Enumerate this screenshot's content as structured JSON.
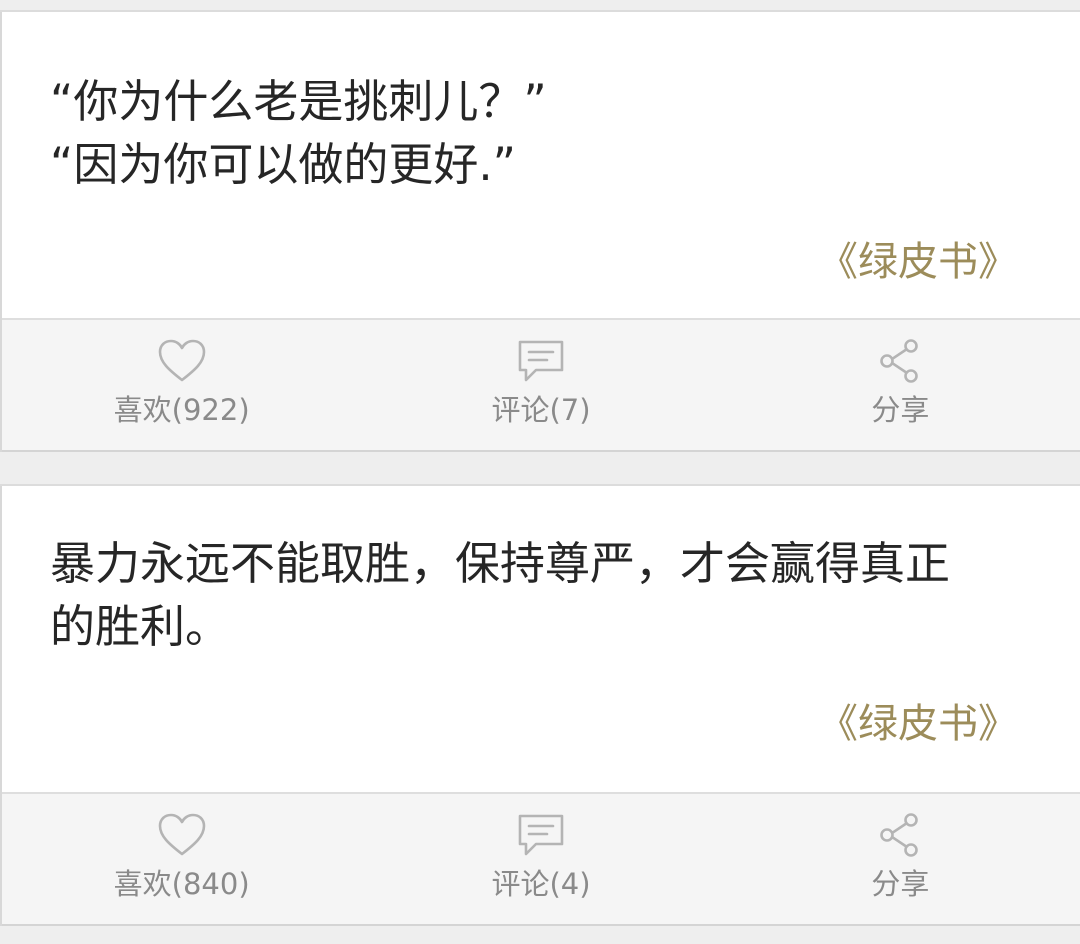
{
  "feed": {
    "cards": [
      {
        "quote": "“你为什么老是挑刺儿？”\n“因为你可以做的更好.”",
        "source": "《绿皮书》",
        "actions": {
          "like_label": "喜欢(922)",
          "comment_label": "评论(7)",
          "share_label": "分享"
        }
      },
      {
        "quote": "暴力永远不能取胜，保持尊严，才会赢得真正\n的胜利。",
        "source": "《绿皮书》",
        "actions": {
          "like_label": "喜欢(840)",
          "comment_label": "评论(4)",
          "share_label": "分享"
        }
      }
    ]
  },
  "icons": {
    "like": "heart-icon",
    "comment": "comment-bubble-icon",
    "share": "share-icon"
  },
  "colors": {
    "source_text": "#9c8c5a",
    "action_label": "#8a8a8a",
    "icon_stroke": "#b4b4b4",
    "quote_text": "#262626"
  }
}
